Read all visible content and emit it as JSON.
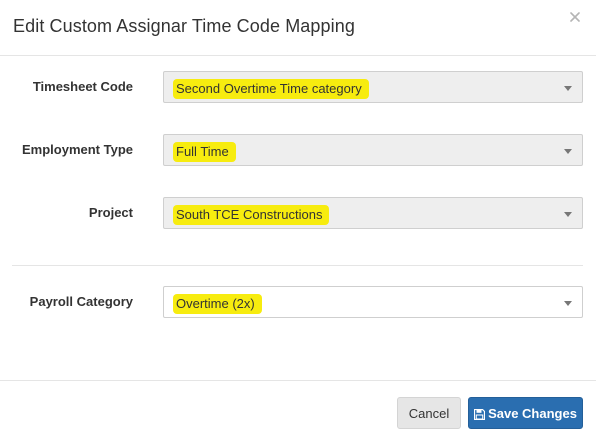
{
  "modal": {
    "title": "Edit Custom Assignar Time Code Mapping",
    "close_icon": "close-icon"
  },
  "fields": [
    {
      "label": "Timesheet Code",
      "value": "Second Overtime Time category",
      "disabled": true,
      "highlighted": true
    },
    {
      "label": "Employment Type",
      "value": "Full Time",
      "disabled": true,
      "highlighted": true
    },
    {
      "label": "Project",
      "value": "South TCE Constructions",
      "disabled": true,
      "highlighted": true
    },
    {
      "label": "Payroll Category",
      "value": "Overtime (2x)",
      "disabled": false,
      "highlighted": true
    }
  ],
  "footer": {
    "cancel_label": "Cancel",
    "save_label": "Save Changes",
    "save_icon": "floppy-disk-icon"
  },
  "colors": {
    "primary": "#2a6eb0",
    "highlight": "#f7ec0f",
    "disabled_bg": "#eeeeee"
  }
}
